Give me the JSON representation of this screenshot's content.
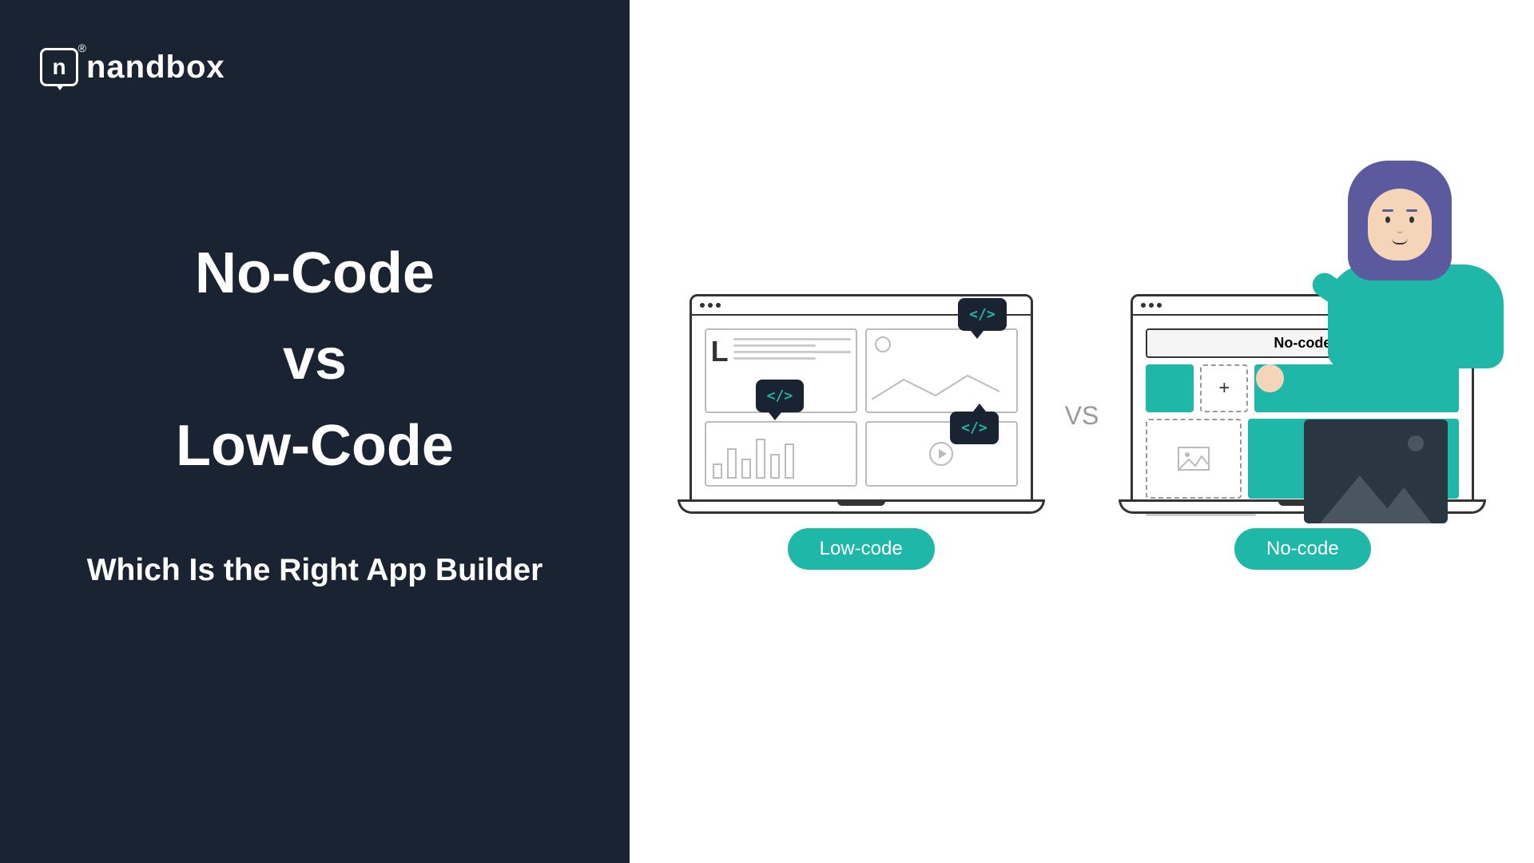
{
  "brand": {
    "name": "nandbox",
    "logo_letter": "n"
  },
  "left": {
    "title_line1": "No-Code",
    "title_line2": "vs",
    "title_line3": "Low-Code",
    "subtitle": "Which Is the Right App Builder"
  },
  "vs_label": "VS",
  "lowcode": {
    "label": "Low-code",
    "code_symbol": "</>",
    "L_letter": "L"
  },
  "nocode": {
    "label": "No-code",
    "header_text": "No-code",
    "plus_symbol": "+"
  }
}
